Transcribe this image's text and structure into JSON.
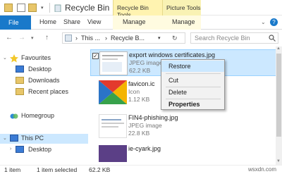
{
  "window": {
    "title": "Recycle Bin",
    "context_tab_recycle": "Recycle Bin Tools",
    "context_tab_picture": "Picture Tools"
  },
  "ribbon": {
    "tabs": [
      "File",
      "Home",
      "Share",
      "View",
      "Manage",
      "Manage"
    ]
  },
  "address": {
    "path_this": "This ...",
    "path_recycle": "Recycle B...",
    "search_placeholder": "Search Recycle Bin"
  },
  "navpane": {
    "items": [
      "Favourites",
      "Desktop",
      "Downloads",
      "Recent places",
      "Homegroup",
      "This PC",
      "Desktop"
    ]
  },
  "files": [
    {
      "name": "export windows certificates.jpg",
      "type": "JPEG image",
      "size": "62.2 KB"
    },
    {
      "name": "favicon.ic",
      "type": "Icon",
      "size": "1.12 KB"
    },
    {
      "name": "FIN4-phishing.jpg",
      "type": "JPEG image",
      "size": "22.8 KB"
    },
    {
      "name": "ie-cyark.jpg",
      "type": "",
      "size": ""
    }
  ],
  "context_menu": {
    "items": [
      "Restore",
      "Cut",
      "Delete",
      "Properties"
    ]
  },
  "status": {
    "item_count": "1 item",
    "selected": "1 item selected",
    "size": "62.2 KB"
  },
  "watermark": "wsxdn.com",
  "colors": {
    "accent": "#1979ca",
    "selection": "#cce8ff",
    "context_tab": "#fff3b0"
  }
}
